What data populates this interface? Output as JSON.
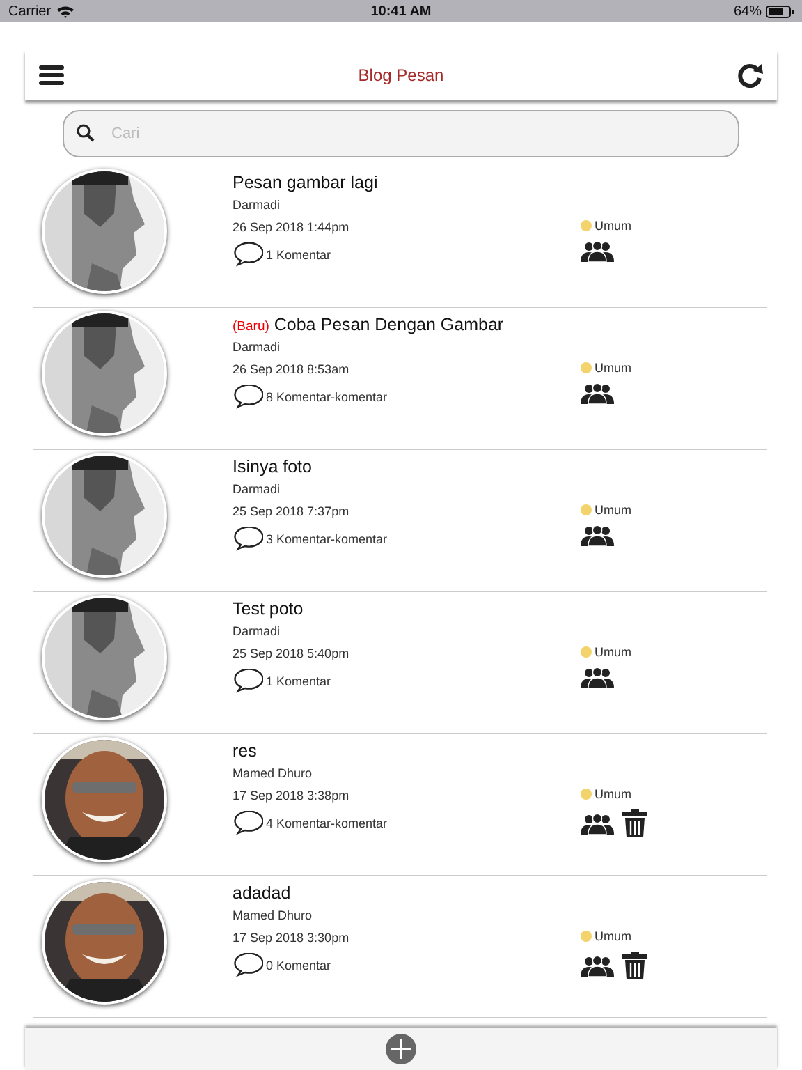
{
  "status_bar": {
    "carrier": "Carrier",
    "time": "10:41 AM",
    "battery": "64%"
  },
  "nav": {
    "title": "Blog Pesan"
  },
  "search": {
    "placeholder": "Cari"
  },
  "posts": [
    {
      "title": "Pesan gambar lagi",
      "author": "Darmadi",
      "date": "26 Sep 2018 1:44pm",
      "comments": "1 Komentar",
      "audience": "Umum",
      "color": "#f3d36b",
      "deletable": false
    },
    {
      "badge": "(Baru)",
      "title": "Coba Pesan Dengan Gambar",
      "author": "Darmadi",
      "date": "26 Sep 2018 8:53am",
      "comments": "8 Komentar-komentar",
      "audience": "Umum",
      "color": "#f3d36b",
      "deletable": false
    },
    {
      "title": "Isinya foto",
      "author": "Darmadi",
      "date": "25 Sep 2018 7:37pm",
      "comments": "3 Komentar-komentar",
      "audience": "Umum",
      "color": "#f3d36b",
      "deletable": false
    },
    {
      "title": "Test poto",
      "author": "Darmadi",
      "date": "25 Sep 2018 5:40pm",
      "comments": "1 Komentar",
      "audience": "Umum",
      "color": "#f3d36b",
      "deletable": false
    },
    {
      "title": "res",
      "author": "Mamed Dhuro",
      "date": "17 Sep 2018 3:38pm",
      "comments": "4 Komentar-komentar",
      "audience": "Umum",
      "color": "#f3d36b",
      "deletable": true
    },
    {
      "title": "adadad",
      "author": "Mamed Dhuro",
      "date": "17 Sep 2018 3:30pm",
      "comments": "0 Komentar",
      "audience": "Umum",
      "color": "#f3d36b",
      "deletable": true
    }
  ]
}
